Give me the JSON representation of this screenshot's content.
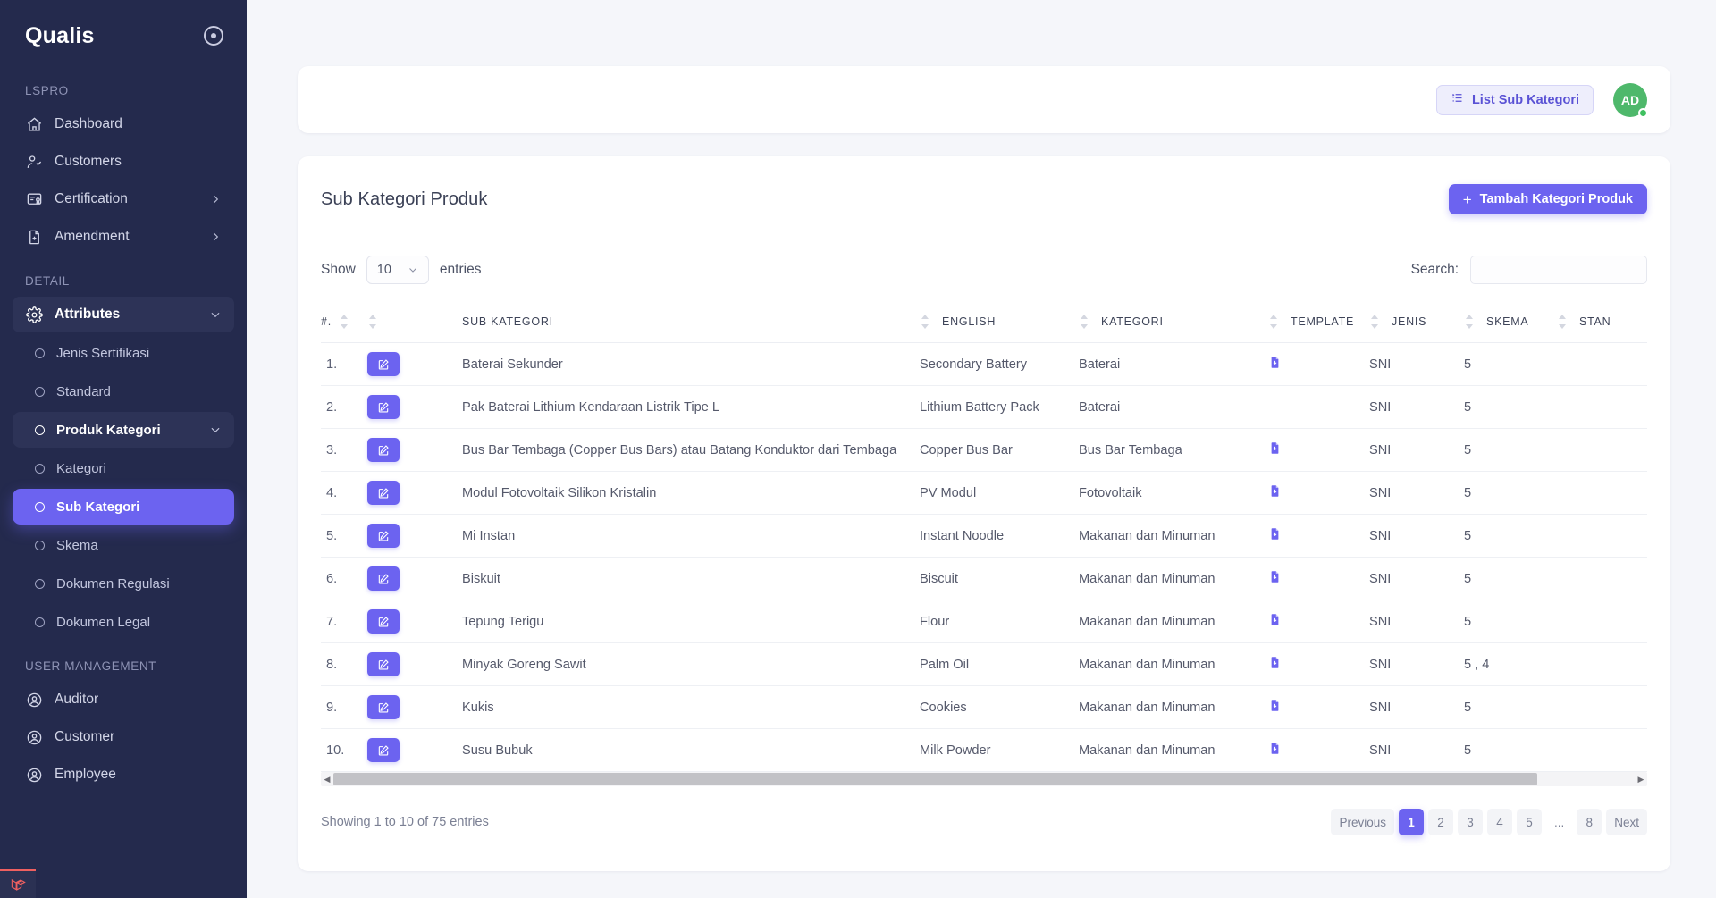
{
  "sidebar": {
    "brand": "Qualis",
    "sections": [
      {
        "label": "LSPRO",
        "items": [
          {
            "label": "Dashboard",
            "icon": "home-icon",
            "chevron": false
          },
          {
            "label": "Customers",
            "icon": "user-check-icon",
            "chevron": false
          },
          {
            "label": "Certification",
            "icon": "certificate-icon",
            "chevron": true
          },
          {
            "label": "Amendment",
            "icon": "file-plus-icon",
            "chevron": true
          }
        ]
      },
      {
        "label": "DETAIL",
        "items": [
          {
            "label": "Attributes",
            "icon": "gear-icon",
            "state": "group-open",
            "chevron": "down"
          }
        ],
        "sub": [
          {
            "label": "Jenis Sertifikasi",
            "state": ""
          },
          {
            "label": "Standard",
            "state": ""
          },
          {
            "label": "Produk Kategori",
            "state": "open",
            "chevron": "down"
          },
          {
            "label": "Kategori",
            "state": ""
          },
          {
            "label": "Sub Kategori",
            "state": "active"
          },
          {
            "label": "Skema",
            "state": ""
          },
          {
            "label": "Dokumen Regulasi",
            "state": ""
          },
          {
            "label": "Dokumen Legal",
            "state": ""
          }
        ]
      },
      {
        "label": "USER MANAGEMENT",
        "items": [
          {
            "label": "Auditor",
            "icon": "user-circle-icon",
            "chevron": false
          },
          {
            "label": "Customer",
            "icon": "user-circle-icon",
            "chevron": false
          },
          {
            "label": "Employee",
            "icon": "user-circle-icon",
            "chevron": false
          }
        ]
      }
    ]
  },
  "topbar": {
    "list_button": "List Sub Kategori",
    "avatar_initials": "AD"
  },
  "card": {
    "title": "Sub Kategori Produk",
    "add_button": "Tambah Kategori Produk",
    "show_label": "Show",
    "entries_label": "entries",
    "page_size": "10",
    "search_label": "Search:",
    "search_value": "",
    "search_placeholder": ""
  },
  "table": {
    "columns": [
      "#.",
      "",
      "SUB KATEGORI",
      "ENGLISH",
      "KATEGORI",
      "TEMPLATE",
      "JENIS",
      "SKEMA",
      "STAN"
    ],
    "rows": [
      {
        "no": "1.",
        "sub": "Baterai Sekunder",
        "english": "Secondary Battery",
        "kategori": "Baterai",
        "template": true,
        "jenis": "SNI",
        "skema": "5"
      },
      {
        "no": "2.",
        "sub": "Pak Baterai Lithium Kendaraan Listrik Tipe L",
        "english": "Lithium Battery Pack",
        "kategori": "Baterai",
        "template": false,
        "jenis": "SNI",
        "skema": "5"
      },
      {
        "no": "3.",
        "sub": "Bus Bar Tembaga (Copper Bus Bars) atau Batang Konduktor dari Tembaga",
        "english": "Copper Bus Bar",
        "kategori": "Bus Bar Tembaga",
        "template": true,
        "jenis": "SNI",
        "skema": "5"
      },
      {
        "no": "4.",
        "sub": "Modul Fotovoltaik Silikon Kristalin",
        "english": "PV Modul",
        "kategori": "Fotovoltaik",
        "template": true,
        "jenis": "SNI",
        "skema": "5"
      },
      {
        "no": "5.",
        "sub": "Mi Instan",
        "english": "Instant Noodle",
        "kategori": "Makanan dan Minuman",
        "template": true,
        "jenis": "SNI",
        "skema": "5"
      },
      {
        "no": "6.",
        "sub": "Biskuit",
        "english": "Biscuit",
        "kategori": "Makanan dan Minuman",
        "template": true,
        "jenis": "SNI",
        "skema": "5"
      },
      {
        "no": "7.",
        "sub": "Tepung Terigu",
        "english": "Flour",
        "kategori": "Makanan dan Minuman",
        "template": true,
        "jenis": "SNI",
        "skema": "5"
      },
      {
        "no": "8.",
        "sub": "Minyak Goreng Sawit",
        "english": "Palm Oil",
        "kategori": "Makanan dan Minuman",
        "template": true,
        "jenis": "SNI",
        "skema": "5 , 4"
      },
      {
        "no": "9.",
        "sub": "Kukis",
        "english": "Cookies",
        "kategori": "Makanan dan Minuman",
        "template": true,
        "jenis": "SNI",
        "skema": "5"
      },
      {
        "no": "10.",
        "sub": "Susu Bubuk",
        "english": "Milk Powder",
        "kategori": "Makanan dan Minuman",
        "template": true,
        "jenis": "SNI",
        "skema": "5"
      }
    ]
  },
  "footer": {
    "info": "Showing 1 to 10 of 75 entries",
    "pagination": [
      {
        "label": "Previous",
        "active": false
      },
      {
        "label": "1",
        "active": true
      },
      {
        "label": "2",
        "active": false
      },
      {
        "label": "3",
        "active": false
      },
      {
        "label": "4",
        "active": false
      },
      {
        "label": "5",
        "active": false
      },
      {
        "label": "...",
        "active": false,
        "ellipsis": true
      },
      {
        "label": "8",
        "active": false
      },
      {
        "label": "Next",
        "active": false
      }
    ]
  },
  "colors": {
    "accent": "#6c63f0",
    "sidebar_bg": "#242a4d",
    "avatar_green": "#4eb86b",
    "page_bg": "#f5f6fa"
  }
}
